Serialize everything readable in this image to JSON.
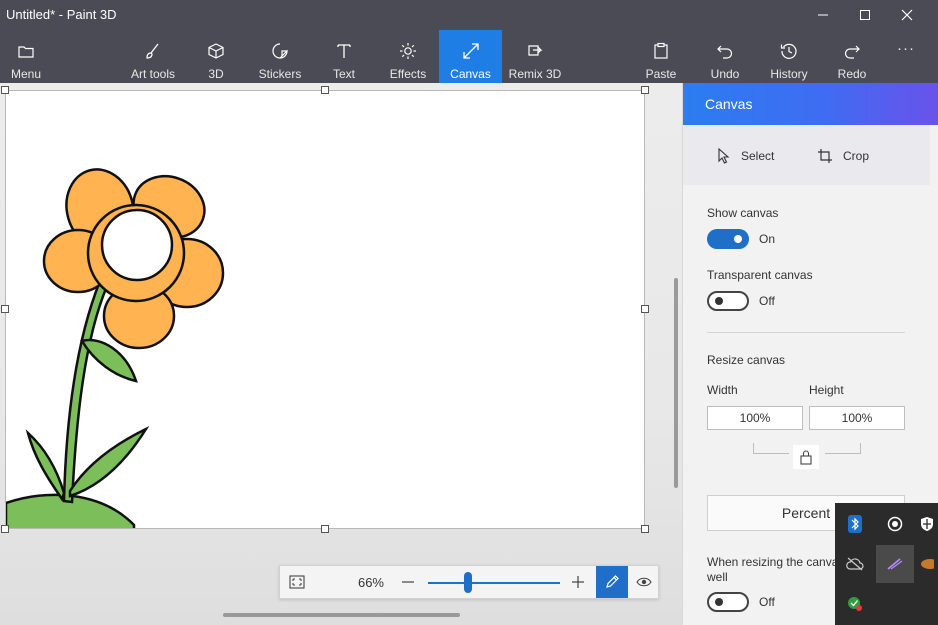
{
  "window": {
    "title": "Untitled* - Paint 3D"
  },
  "ribbon": {
    "items": [
      {
        "id": "menu",
        "label": "Menu"
      },
      {
        "id": "art_tools",
        "label": "Art tools"
      },
      {
        "id": "3d",
        "label": "3D"
      },
      {
        "id": "stickers",
        "label": "Stickers"
      },
      {
        "id": "text",
        "label": "Text"
      },
      {
        "id": "effects",
        "label": "Effects"
      },
      {
        "id": "canvas",
        "label": "Canvas"
      },
      {
        "id": "remix",
        "label": "Remix 3D"
      },
      {
        "id": "paste",
        "label": "Paste"
      },
      {
        "id": "undo",
        "label": "Undo"
      },
      {
        "id": "history",
        "label": "History"
      },
      {
        "id": "redo",
        "label": "Redo"
      }
    ],
    "active": "Canvas",
    "more_label": "···"
  },
  "zoom": {
    "percent_label": "66%",
    "minus_label": "—",
    "plus_label": "+",
    "level_fraction": 0.3
  },
  "panel": {
    "title": "Canvas",
    "select_label": "Select",
    "crop_label": "Crop",
    "show_canvas": {
      "label": "Show canvas",
      "state_label": "On",
      "on": true
    },
    "transparent_canvas": {
      "label": "Transparent canvas",
      "state_label": "Off",
      "on": false
    },
    "resize": {
      "heading": "Resize canvas",
      "width_label": "Width",
      "height_label": "Height",
      "width_value": "100%",
      "height_value": "100%",
      "unit_button": "Percent"
    },
    "resize_image": {
      "label": "When resizing the canvas, resize the image as well",
      "label_visible": "When resizing the canvas, image as well",
      "state_label": "Off",
      "on": false
    }
  },
  "colors": {
    "chrome": "#4b4b55",
    "accent": "#1f7ee6",
    "petal": "#ffb451",
    "stem": "#7cbf5a",
    "outline": "#111111"
  },
  "tray": {
    "icons": [
      "bluetooth-icon",
      "record-icon",
      "security-shield-icon",
      "cloud-off-icon",
      "pen-icon",
      "orange-app-icon",
      "green-check-icon"
    ]
  }
}
